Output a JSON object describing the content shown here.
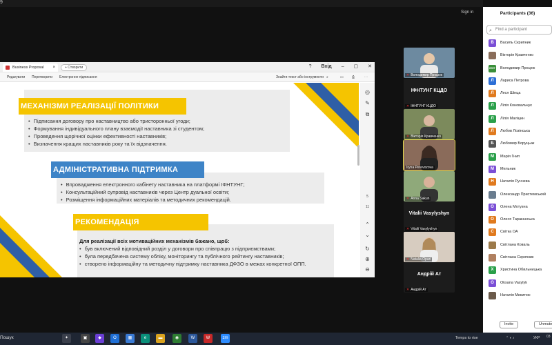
{
  "zoom": {
    "top_counter": "9",
    "sign_in": "Sign in"
  },
  "browser": {
    "tab_title": "Business Proposal",
    "new_tab": "+ Створити",
    "login": "Вхід",
    "toolbar": [
      "Редагувати",
      "Перетворити",
      "Електронне підписання"
    ],
    "search_placeholder": "Знайти текст або інструменти"
  },
  "document": {
    "section1": {
      "title": "МЕХАНІЗМИ РЕАЛІЗАЦІЇ ПОЛІТИКИ",
      "items": [
        "Підписання договору про наставництво або тристоронньої угоди;",
        "Формування індивідуального плану взаємодії наставника зі студентом;",
        "Проведення щорічної оцінки ефективності наставників;",
        "Визначення кращих наставників року та їх відзначення."
      ]
    },
    "section2": {
      "title": "АДМІНІСТРАТИВНА ПІДТРИМКА",
      "items": [
        "Впровадження електронного кабінету наставника на платформі ІФНТУНГ;",
        "Консультаційний супровід наставників через Центр дуальної освіти;",
        "Розміщення інформаційних матеріалів та методичних рекомендацій."
      ]
    },
    "section3": {
      "title": "РЕКОМЕНДАЦІЯ",
      "intro": "Для реалізації всіх мотиваційних механізмів бажано, щоб:",
      "items": [
        "був включений відповідний розділ у договори про співпрацю з підприємствами;",
        "була передбачена систему обліку, моніторингу та публічного рейтингу наставників;",
        "створено інформаційну та методичну підтримку наставника ДФЗО в межах конкретної ОПП."
      ]
    },
    "page_current": "5",
    "page_total": "11"
  },
  "videos": [
    {
      "name": "Володимир Процюк",
      "style": "photo",
      "bg": "#6d8aa0"
    },
    {
      "name": "ІФНТУНГ КЦДО",
      "big": "ІФНТУНГ КЦДО",
      "style": "dark"
    },
    {
      "name": "Вікторія Кравченко",
      "style": "photo",
      "bg": "#7c8a5c"
    },
    {
      "name": "Iryna Perevozova",
      "style": "photo",
      "bg": "#8a6b5a",
      "active": true
    },
    {
      "name": "Anna Sakun",
      "style": "photo",
      "bg": "#5f7f6a"
    },
    {
      "name": "Vitalii Vasylyshyn",
      "big": "Vitalii Vasylyshyn",
      "style": "dark"
    },
    {
      "name": "Natalia Opari",
      "style": "photo",
      "bg": "#c9b6a4"
    },
    {
      "name": "Андрій Ат",
      "big": "Андрій Ат",
      "style": "dark"
    }
  ],
  "participants": {
    "title": "Participants (36)",
    "search_placeholder": "Find a participant",
    "list": [
      {
        "initial": "В",
        "name": "Василь Скрипник",
        "color": "#7b4fd6"
      },
      {
        "initial": "",
        "name": "Вікторія Кравченко",
        "color": "#8a6d5a"
      },
      {
        "initial": "ІФНТ",
        "name": "Володимир Процюк",
        "color": "#3a8f3a"
      },
      {
        "initial": "Л",
        "name": "Лариса Петрова",
        "color": "#2d6fd6"
      },
      {
        "initial": "Л",
        "name": "Леся Шінца",
        "color": "#e07a1e"
      },
      {
        "initial": "Л",
        "name": "Лілія Коновальчук",
        "color": "#2aa04a"
      },
      {
        "initial": "Л",
        "name": "Лілія Маліцин",
        "color": "#2aa04a"
      },
      {
        "initial": "Л",
        "name": "Любов Лозінська",
        "color": "#e07a1e"
      },
      {
        "initial": "Б",
        "name": "Любомир Боруцьак",
        "color": "#555555"
      },
      {
        "initial": "М",
        "name": "Марія Гнип",
        "color": "#2aa04a"
      },
      {
        "initial": "М",
        "name": "Мельник",
        "color": "#7b4fd6"
      },
      {
        "initial": "Н",
        "name": "Наталія Рунчева",
        "color": "#e07a1e"
      },
      {
        "initial": "",
        "name": "Олександр Пристемський",
        "color": "#6a7d8f"
      },
      {
        "initial": "О",
        "name": "Олена Мотузна",
        "color": "#7b4fd6"
      },
      {
        "initial": "О",
        "name": "Олеся Тараканська",
        "color": "#e07a1e"
      },
      {
        "initial": "С",
        "name": "Світка ОА",
        "color": "#e07a1e"
      },
      {
        "initial": "",
        "name": "Світлана Коваль",
        "color": "#9c7a4a"
      },
      {
        "initial": "",
        "name": "Світлана Скрипник",
        "color": "#b08060"
      },
      {
        "initial": "Х",
        "name": "Христина Обильницька",
        "color": "#2aa04a"
      },
      {
        "initial": "О",
        "name": "Oksana Vasylyk",
        "color": "#7b4fd6"
      },
      {
        "initial": "",
        "name": "Наталія Микитюк",
        "color": "#6b5a4a"
      }
    ],
    "invite": "Invite",
    "mute": "Unmute"
  },
  "taskbar": {
    "search": "Пошук",
    "weather": "Temps to rise",
    "lang": "УКР",
    "time": "03"
  }
}
